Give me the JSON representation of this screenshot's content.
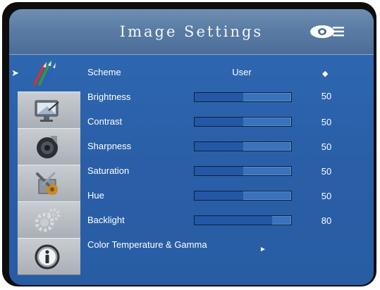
{
  "header": {
    "title": "Image Settings",
    "logo_icon": "projector-icon"
  },
  "sidebar": {
    "tabs": [
      {
        "name": "image-settings",
        "icon": "paint-brushes-icon",
        "active": true
      },
      {
        "name": "display",
        "icon": "monitor-icon",
        "active": false
      },
      {
        "name": "audio",
        "icon": "speaker-icon",
        "active": false
      },
      {
        "name": "setup",
        "icon": "tools-icon",
        "active": false
      },
      {
        "name": "advanced",
        "icon": "gears-icon",
        "active": false
      },
      {
        "name": "information",
        "icon": "info-icon",
        "active": false
      }
    ],
    "pointer_glyph": "➤"
  },
  "settings": {
    "scheme": {
      "label": "Scheme",
      "value": "User",
      "arrows": "◆"
    },
    "brightness": {
      "label": "Brightness",
      "value": "50",
      "level": 0.5
    },
    "contrast": {
      "label": "Contrast",
      "value": "50",
      "level": 0.5
    },
    "sharpness": {
      "label": "Sharpness",
      "value": "50",
      "level": 0.5
    },
    "saturation": {
      "label": "Saturation",
      "value": "50",
      "level": 0.5
    },
    "hue": {
      "label": "Hue",
      "value": "50",
      "level": 0.5
    },
    "backlight": {
      "label": "Backlight",
      "value": "80",
      "level": 0.8
    },
    "color_temperature": {
      "label": "Color Temperature & Gamma",
      "arrow": "►"
    }
  },
  "colors": {
    "panel": "#2a5fa7",
    "header": "#5a7ca4",
    "bar_fill": "#2458a6",
    "tab": "#b9bec4"
  }
}
